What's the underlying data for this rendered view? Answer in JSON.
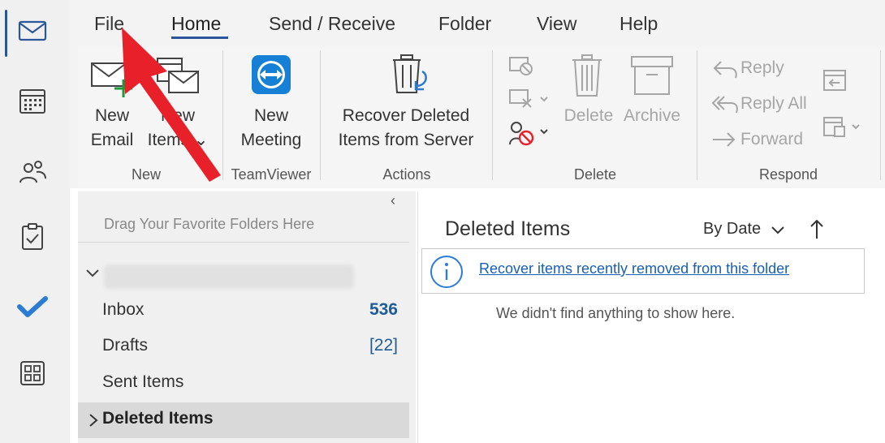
{
  "menu_tabs": [
    "File",
    "Home",
    "Send / Receive",
    "Folder",
    "View",
    "Help"
  ],
  "ribbon": {
    "new_group": {
      "label": "New",
      "new_email": [
        "New",
        "Email"
      ],
      "new_items": [
        "New",
        "Items ⌄"
      ]
    },
    "teamviewer_group": {
      "label": "TeamViewer",
      "new_meeting": [
        "New",
        "Meeting"
      ]
    },
    "actions_group": {
      "label": "Actions",
      "recover": [
        "Recover Deleted",
        "Items from Server"
      ]
    },
    "delete_group": {
      "label": "Delete",
      "delete": "Delete",
      "archive": "Archive"
    },
    "respond_group": {
      "label": "Respond",
      "reply": "Reply",
      "reply_all": "Reply All",
      "forward": "Forward"
    }
  },
  "folder_pane": {
    "drag_hint": "Drag Your Favorite Folders Here",
    "collapse": "‹",
    "folders": [
      {
        "name": "Inbox",
        "count": "536"
      },
      {
        "name": "Drafts",
        "count": "[22]"
      },
      {
        "name": "Sent Items",
        "count": ""
      },
      {
        "name": "Deleted Items",
        "count": ""
      }
    ]
  },
  "message_list": {
    "title": "Deleted Items",
    "sort_label": "By Date",
    "info_link": "Recover items recently removed from this folder",
    "empty_text": "We didn't find anything to show here."
  },
  "colors": {
    "accent": "#2b579a",
    "count_blue": "#1f5c99",
    "annotation_red": "#e8202a"
  },
  "icons": {
    "appbar": [
      "mail-icon",
      "calendar-icon",
      "people-icon",
      "tasks-icon",
      "todo-check-icon",
      "apps-icon"
    ]
  }
}
